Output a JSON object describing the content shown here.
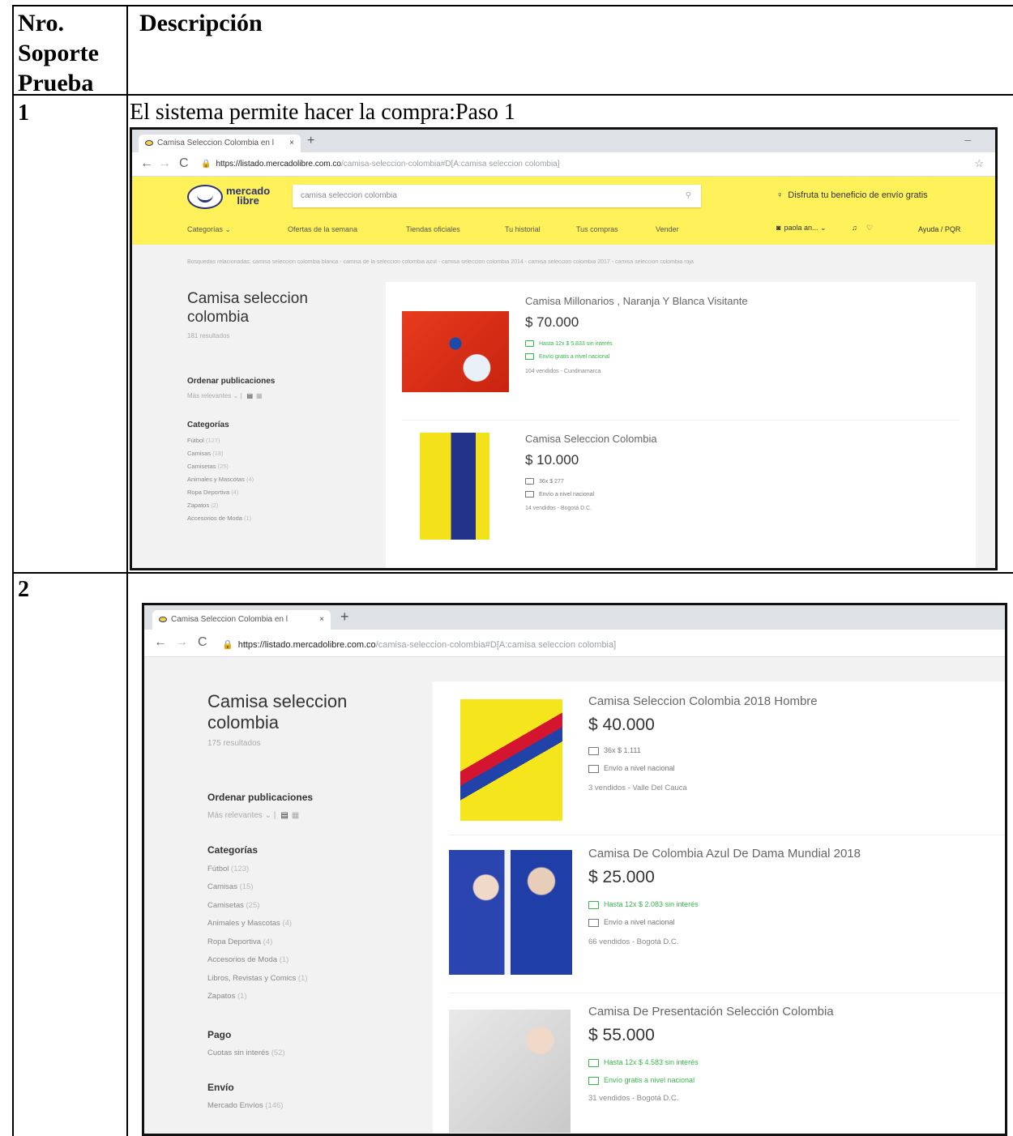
{
  "table": {
    "col1_header": [
      "Nro.",
      "Soporte",
      "Prueba"
    ],
    "col2_header": "Descripción",
    "rows": [
      {
        "number": "1",
        "caption": "El sistema permite hacer la compra:Paso 1"
      },
      {
        "number": "2",
        "caption": ""
      }
    ]
  },
  "shot1": {
    "tab_title": "Camisa Seleccion Colombia en l",
    "tab_close": "×",
    "new_tab": "+",
    "minimize": "–",
    "url_lock": "🔒",
    "url_host": "https://listado.mercadolibre.com.co",
    "url_path": "/camisa-seleccion-colombia#D[A:camisa seleccion colombia]",
    "brand": [
      "mercado",
      "libre"
    ],
    "search_value": "camisa seleccion colombia",
    "search_icon": "magnifier",
    "promo": "Disfruta tu beneficio de envío gratis",
    "menu": [
      "Categorías ⌄",
      "Ofertas de la semana",
      "Tiendas oficiales",
      "Tu historial",
      "Tus compras",
      "Vender"
    ],
    "user_name": "paola an... ⌄",
    "help": "Ayuda / PQR",
    "breadcrumbs": "Búsquedas relacionadas: camisa seleccion colombia blanca  -  camisa de la seleccion colombia azul  -  camisa seleccion colombia 2014  -  camisa seleccion colombia 2017  -  camisa seleccion colombia roja",
    "query_title": "Camisa seleccion colombia",
    "results_count": "181 resultados",
    "sort_heading": "Ordenar publicaciones",
    "sort_value": "Más relevantes ⌄ |",
    "categories_heading": "Categorías",
    "categories": [
      {
        "name": "Fútbol",
        "count": "(127)"
      },
      {
        "name": "Camisas",
        "count": "(18)"
      },
      {
        "name": "Camisetas",
        "count": "(25)"
      },
      {
        "name": "Animales y Mascotas",
        "count": "(4)"
      },
      {
        "name": "Ropa Deportiva",
        "count": "(4)"
      },
      {
        "name": "Zapatos",
        "count": "(2)"
      },
      {
        "name": "Accesorios de Moda",
        "count": "(1)"
      }
    ],
    "items": [
      {
        "title": "Camisa Millonarios , Naranja Y Blanca Visitante",
        "price": "$ 70.000",
        "installments": "Hasta 12x $ 5.833 sin interés",
        "shipping": "Envío gratis a nivel nacional",
        "sold": "104 vendidos - Cundinamarca"
      },
      {
        "title": "Camisa Seleccion Colombia",
        "price": "$ 10.000",
        "installments": "36x $ 277",
        "shipping": "Envío a nivel nacional",
        "sold": "14 vendidos - Bogotá D.C."
      }
    ]
  },
  "shot2": {
    "tab_title": "Camisa Seleccion Colombia en l",
    "tab_close": "×",
    "new_tab": "+",
    "url_lock": "🔒",
    "url_host": "https://listado.mercadolibre.com.co",
    "url_path": "/camisa-seleccion-colombia#D[A:camisa seleccion colombia]",
    "query_title": "Camisa seleccion colombia",
    "results_count": "175 resultados",
    "sort_heading": "Ordenar publicaciones",
    "sort_value": "Más relevantes ⌄ |",
    "categories_heading": "Categorías",
    "categories": [
      {
        "name": "Fútbol",
        "count": "(123)"
      },
      {
        "name": "Camisas",
        "count": "(15)"
      },
      {
        "name": "Camisetas",
        "count": "(25)"
      },
      {
        "name": "Animales y Mascotas",
        "count": "(4)"
      },
      {
        "name": "Ropa Deportiva",
        "count": "(4)"
      },
      {
        "name": "Accesorios de Moda",
        "count": "(1)"
      },
      {
        "name": "Libros, Revistas y Comics",
        "count": "(1)"
      },
      {
        "name": "Zapatos",
        "count": "(1)"
      }
    ],
    "payment_heading": "Pago",
    "payment_option": {
      "name": "Cuotas sin interés",
      "count": "(52)"
    },
    "shipping_heading": "Envío",
    "shipping_option": {
      "name": "Mercado Envíos",
      "count": "(146)"
    },
    "items": [
      {
        "title": "Camisa Seleccion Colombia 2018 Hombre",
        "price": "$ 40.000",
        "installments": "36x $ 1.111",
        "shipping": "Envío a nivel nacional",
        "sold": "3 vendidos - Valle Del Cauca"
      },
      {
        "title": "Camisa De Colombia Azul De Dama Mundial 2018",
        "price": "$ 25.000",
        "installments": "Hasta 12x $ 2.083 sin interés",
        "shipping": "Envío a nivel nacional",
        "sold": "66 vendidos - Bogotá D.C."
      },
      {
        "title": "Camisa De Presentación Selección Colombia",
        "price": "$ 55.000",
        "installments": "Hasta 12x $ 4.583 sin interés",
        "shipping": "Envío gratis a nivel nacional",
        "sold": "31 vendidos - Bogotá D.C."
      }
    ]
  },
  "colors": {
    "ml_yellow": "#fff159",
    "ml_blue": "#2d3277",
    "green": "#39b54a"
  }
}
